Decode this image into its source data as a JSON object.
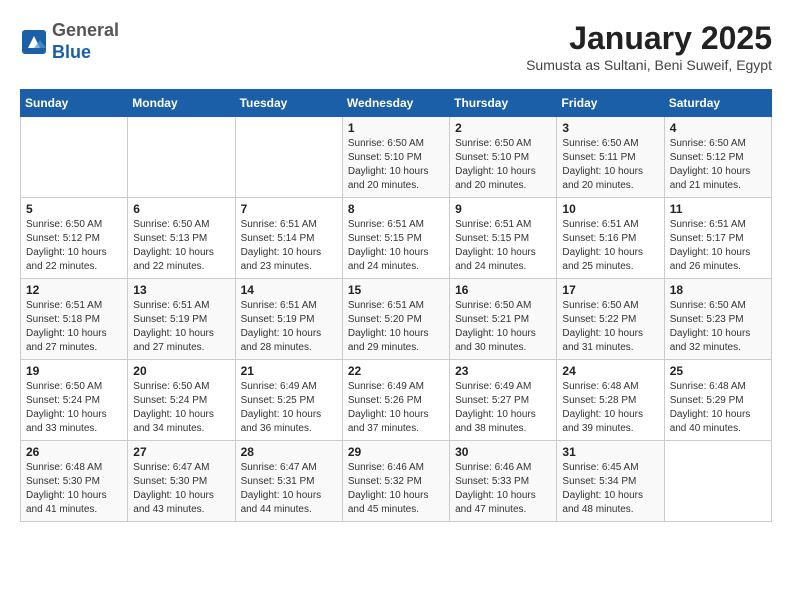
{
  "header": {
    "logo_line1": "General",
    "logo_line2": "Blue",
    "month_title": "January 2025",
    "subtitle": "Sumusta as Sultani, Beni Suweif, Egypt"
  },
  "days_of_week": [
    "Sunday",
    "Monday",
    "Tuesday",
    "Wednesday",
    "Thursday",
    "Friday",
    "Saturday"
  ],
  "weeks": [
    [
      {
        "day": "",
        "info": ""
      },
      {
        "day": "",
        "info": ""
      },
      {
        "day": "",
        "info": ""
      },
      {
        "day": "1",
        "info": "Sunrise: 6:50 AM\nSunset: 5:10 PM\nDaylight: 10 hours\nand 20 minutes."
      },
      {
        "day": "2",
        "info": "Sunrise: 6:50 AM\nSunset: 5:10 PM\nDaylight: 10 hours\nand 20 minutes."
      },
      {
        "day": "3",
        "info": "Sunrise: 6:50 AM\nSunset: 5:11 PM\nDaylight: 10 hours\nand 20 minutes."
      },
      {
        "day": "4",
        "info": "Sunrise: 6:50 AM\nSunset: 5:12 PM\nDaylight: 10 hours\nand 21 minutes."
      }
    ],
    [
      {
        "day": "5",
        "info": "Sunrise: 6:50 AM\nSunset: 5:12 PM\nDaylight: 10 hours\nand 22 minutes."
      },
      {
        "day": "6",
        "info": "Sunrise: 6:50 AM\nSunset: 5:13 PM\nDaylight: 10 hours\nand 22 minutes."
      },
      {
        "day": "7",
        "info": "Sunrise: 6:51 AM\nSunset: 5:14 PM\nDaylight: 10 hours\nand 23 minutes."
      },
      {
        "day": "8",
        "info": "Sunrise: 6:51 AM\nSunset: 5:15 PM\nDaylight: 10 hours\nand 24 minutes."
      },
      {
        "day": "9",
        "info": "Sunrise: 6:51 AM\nSunset: 5:15 PM\nDaylight: 10 hours\nand 24 minutes."
      },
      {
        "day": "10",
        "info": "Sunrise: 6:51 AM\nSunset: 5:16 PM\nDaylight: 10 hours\nand 25 minutes."
      },
      {
        "day": "11",
        "info": "Sunrise: 6:51 AM\nSunset: 5:17 PM\nDaylight: 10 hours\nand 26 minutes."
      }
    ],
    [
      {
        "day": "12",
        "info": "Sunrise: 6:51 AM\nSunset: 5:18 PM\nDaylight: 10 hours\nand 27 minutes."
      },
      {
        "day": "13",
        "info": "Sunrise: 6:51 AM\nSunset: 5:19 PM\nDaylight: 10 hours\nand 27 minutes."
      },
      {
        "day": "14",
        "info": "Sunrise: 6:51 AM\nSunset: 5:19 PM\nDaylight: 10 hours\nand 28 minutes."
      },
      {
        "day": "15",
        "info": "Sunrise: 6:51 AM\nSunset: 5:20 PM\nDaylight: 10 hours\nand 29 minutes."
      },
      {
        "day": "16",
        "info": "Sunrise: 6:50 AM\nSunset: 5:21 PM\nDaylight: 10 hours\nand 30 minutes."
      },
      {
        "day": "17",
        "info": "Sunrise: 6:50 AM\nSunset: 5:22 PM\nDaylight: 10 hours\nand 31 minutes."
      },
      {
        "day": "18",
        "info": "Sunrise: 6:50 AM\nSunset: 5:23 PM\nDaylight: 10 hours\nand 32 minutes."
      }
    ],
    [
      {
        "day": "19",
        "info": "Sunrise: 6:50 AM\nSunset: 5:24 PM\nDaylight: 10 hours\nand 33 minutes."
      },
      {
        "day": "20",
        "info": "Sunrise: 6:50 AM\nSunset: 5:24 PM\nDaylight: 10 hours\nand 34 minutes."
      },
      {
        "day": "21",
        "info": "Sunrise: 6:49 AM\nSunset: 5:25 PM\nDaylight: 10 hours\nand 36 minutes."
      },
      {
        "day": "22",
        "info": "Sunrise: 6:49 AM\nSunset: 5:26 PM\nDaylight: 10 hours\nand 37 minutes."
      },
      {
        "day": "23",
        "info": "Sunrise: 6:49 AM\nSunset: 5:27 PM\nDaylight: 10 hours\nand 38 minutes."
      },
      {
        "day": "24",
        "info": "Sunrise: 6:48 AM\nSunset: 5:28 PM\nDaylight: 10 hours\nand 39 minutes."
      },
      {
        "day": "25",
        "info": "Sunrise: 6:48 AM\nSunset: 5:29 PM\nDaylight: 10 hours\nand 40 minutes."
      }
    ],
    [
      {
        "day": "26",
        "info": "Sunrise: 6:48 AM\nSunset: 5:30 PM\nDaylight: 10 hours\nand 41 minutes."
      },
      {
        "day": "27",
        "info": "Sunrise: 6:47 AM\nSunset: 5:30 PM\nDaylight: 10 hours\nand 43 minutes."
      },
      {
        "day": "28",
        "info": "Sunrise: 6:47 AM\nSunset: 5:31 PM\nDaylight: 10 hours\nand 44 minutes."
      },
      {
        "day": "29",
        "info": "Sunrise: 6:46 AM\nSunset: 5:32 PM\nDaylight: 10 hours\nand 45 minutes."
      },
      {
        "day": "30",
        "info": "Sunrise: 6:46 AM\nSunset: 5:33 PM\nDaylight: 10 hours\nand 47 minutes."
      },
      {
        "day": "31",
        "info": "Sunrise: 6:45 AM\nSunset: 5:34 PM\nDaylight: 10 hours\nand 48 minutes."
      },
      {
        "day": "",
        "info": ""
      }
    ]
  ]
}
